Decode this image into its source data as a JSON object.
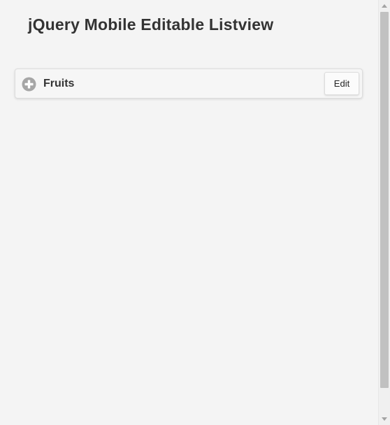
{
  "page": {
    "title": "jQuery Mobile Editable Listview"
  },
  "list": {
    "items": [
      {
        "label": "Fruits",
        "icon": "plus-circle-icon",
        "edit_label": "Edit"
      }
    ]
  },
  "colors": {
    "background": "#f4f4f4",
    "text": "#333333",
    "icon": "#a6a6a6"
  }
}
